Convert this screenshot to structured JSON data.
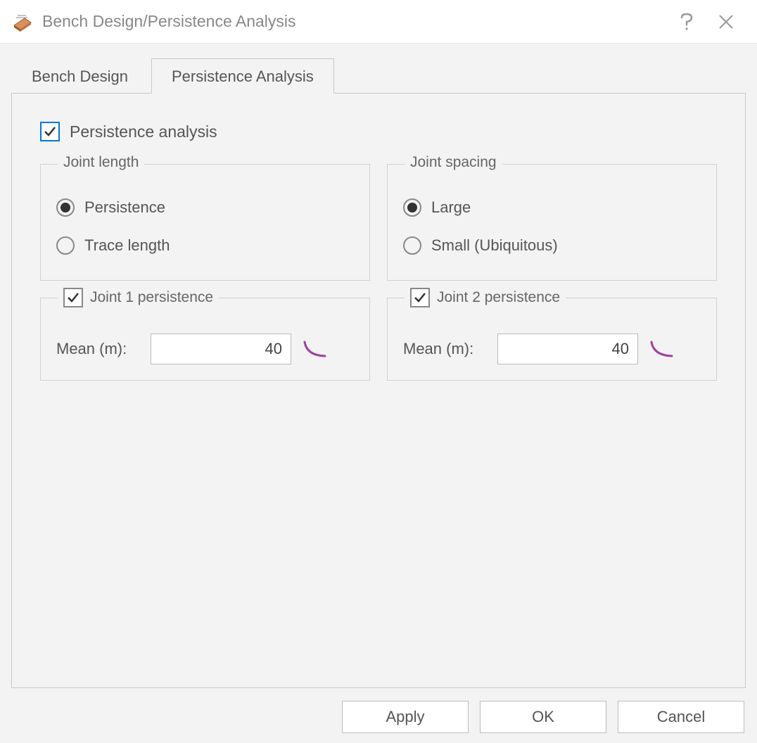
{
  "window": {
    "title": "Bench Design/Persistence Analysis"
  },
  "tabs": [
    {
      "label": "Bench Design",
      "active": false
    },
    {
      "label": "Persistence Analysis",
      "active": true
    }
  ],
  "persistence_analysis_checkbox": {
    "label": "Persistence analysis",
    "checked": true
  },
  "joint_length": {
    "legend": "Joint length",
    "options": [
      {
        "label": "Persistence",
        "checked": true
      },
      {
        "label": "Trace length",
        "checked": false
      }
    ]
  },
  "joint_spacing": {
    "legend": "Joint spacing",
    "options": [
      {
        "label": "Large",
        "checked": true
      },
      {
        "label": "Small (Ubiquitous)",
        "checked": false
      }
    ]
  },
  "joint1": {
    "legend": "Joint 1 persistence",
    "checked": true,
    "mean_label": "Mean (m):",
    "mean_value": "40"
  },
  "joint2": {
    "legend": "Joint 2 persistence",
    "checked": true,
    "mean_label": "Mean (m):",
    "mean_value": "40"
  },
  "buttons": {
    "apply": "Apply",
    "ok": "OK",
    "cancel": "Cancel"
  }
}
